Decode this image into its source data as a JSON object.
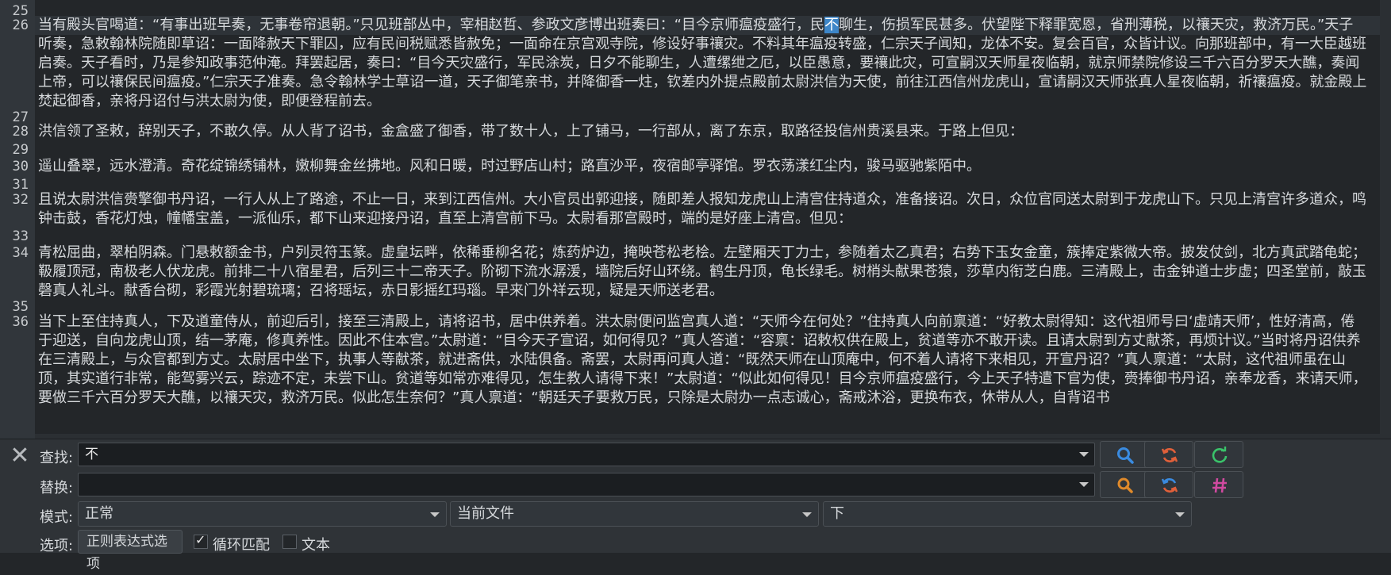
{
  "editor": {
    "lines": [
      {
        "num": "25",
        "text": ""
      },
      {
        "num": "26",
        "before": "当有殿头官喝道：“有事出班早奏，无事卷帘退朝。”只见班部丛中，宰相赵哲、参政文彦博出班奏曰：“目今京师瘟疫盛行，民",
        "selected": "不",
        "after": "聊生，伤损军民甚多。伏望陛下释罪宽恩，省刑薄税，以禳天灾，救济万民。”天子听奏，急敕翰林院随即草诏：一面降赦天下罪囚，应有民间税赋悉皆赦免；一面命在京宫观寺院，修设好事禳灾。不料其年瘟疫转盛，仁宗天子闻知，龙体不安。复会百官，众皆计议。向那班部中，有一大臣越班启奏。天子看时，乃是参知政事范仲淹。拜罢起居，奏曰：“目今天灾盛行，军民涂炭，日夕不能聊生，人遭缧绁之厄，以臣愚意，要禳此灾，可宣嗣汉天师星夜临朝，就京师禁院修设三千六百分罗天大醮，奏闻上帝，可以禳保民间瘟疫。”仁宗天子准奏。急令翰林学士草诏一道，天子御笔亲书，并降御香一炷，钦差内外提点殿前太尉洪信为天使，前往江西信州龙虎山，宣请嗣汉天师张真人星夜临朝，祈禳瘟疫。就金殿上焚起御香，亲将丹诏付与洪太尉为使，即便登程前去。"
      },
      {
        "num": "27",
        "text": ""
      },
      {
        "num": "28",
        "text": "洪信领了圣敕，辞别天子，不敢久停。从人背了诏书，金盒盛了御香，带了数十人，上了铺马，一行部从，离了东京，取路径投信州贵溪县来。于路上但见："
      },
      {
        "num": "29",
        "text": ""
      },
      {
        "num": "30",
        "text": "遥山叠翠，远水澄清。奇花绽锦绣铺林，嫩柳舞金丝拂地。风和日暖，时过野店山村；路直沙平，夜宿邮亭驿馆。罗衣荡漾红尘内，骏马驱驰紫陌中。"
      },
      {
        "num": "31",
        "text": ""
      },
      {
        "num": "32",
        "text": "且说太尉洪信赍擎御书丹诏，一行人从上了路途，不止一日，来到江西信州。大小官员出郭迎接，随即差人报知龙虎山上清宫住持道众，准备接诏。次日，众位官同送太尉到于龙虎山下。只见上清宫许多道众，鸣钟击鼓，香花灯烛，幢幡宝盖，一派仙乐，都下山来迎接丹诏，直至上清宫前下马。太尉看那宫殿时，端的是好座上清宫。但见："
      },
      {
        "num": "33",
        "text": ""
      },
      {
        "num": "34",
        "text": "青松屈曲，翠柏阴森。门悬敕额金书，户列灵符玉篆。虚皇坛畔，依稀垂柳名花；炼药炉边，掩映苍松老桧。左壁厢天丁力士，参随着太乙真君；右势下玉女金童，簇捧定紫微大帝。披发仗剑，北方真武踏龟蛇；靸履顶冠，南极老人伏龙虎。前排二十八宿星君，后列三十二帝天子。阶砌下流水潺湲，墙院后好山环绕。鹤生丹顶，龟长绿毛。树梢头献果苍猿，莎草内衔芝白鹿。三清殿上，击金钟道士步虚；四圣堂前，敲玉磬真人礼斗。献香台砌，彩霞光射碧琉璃；召将瑶坛，赤日影摇红玛瑙。早来门外祥云现，疑是天师送老君。"
      },
      {
        "num": "35",
        "text": ""
      },
      {
        "num": "36",
        "text": "当下上至住持真人，下及道童侍从，前迎后引，接至三清殿上，请将诏书，居中供养着。洪太尉便问监宫真人道：“天师今在何处？”住持真人向前禀道：“好教太尉得知：这代祖师号曰‘虚靖天师’，性好清高，倦于迎送，自向龙虎山顶，结一茅庵，修真养性。因此不住本宫。”太尉道：“目今天子宣诏，如何得见？”真人答道：“容禀：诏敕权供在殿上，贫道等亦不敢开读。且请太尉到方丈献茶，再烦计议。”当时将丹诏供养在三清殿上，与众官都到方丈。太尉居中坐下，执事人等献茶，就进斋供，水陆俱备。斋罢，太尉再问真人道：“既然天师在山顶庵中，何不着人请将下来相见，开宣丹诏？”真人禀道：“太尉，这代祖师虽在山顶，其实道行非常，能驾雾兴云，踪迹不定，未尝下山。贫道等如常亦难得见，怎生教人请得下来！”太尉道：“似此如何得见！目今京师瘟疫盛行，今上天子特遣下官为使，赍捧御书丹诏，亲奉龙香，来请天师，要做三千六百分罗天大醮，以禳天灾，救济万民。似此怎生奈何？”真人禀道：“朝廷天子要救万民，只除是太尉办一点志诚心，斋戒沐浴，更换布衣，休带从人，自背诏书"
      }
    ]
  },
  "find_panel": {
    "find_label": "查找:",
    "find_value": "不",
    "replace_label": "替换:",
    "replace_value": "",
    "mode_label": "模式:",
    "mode_value": "正常",
    "scope_value": "当前文件",
    "direction_value": "下",
    "options_label": "选项:",
    "regex_options_label": "正则表达式选项",
    "wrap_label": "循环匹配",
    "wrap_checked": true,
    "text_label": "文本",
    "text_checked": false
  },
  "colors": {
    "search_icon": "#3a8be0",
    "replace_icon": "#e0603a",
    "green_icon": "#3ac26a",
    "hash_icon": "#d04aa0",
    "selection": "#3d86c8"
  }
}
